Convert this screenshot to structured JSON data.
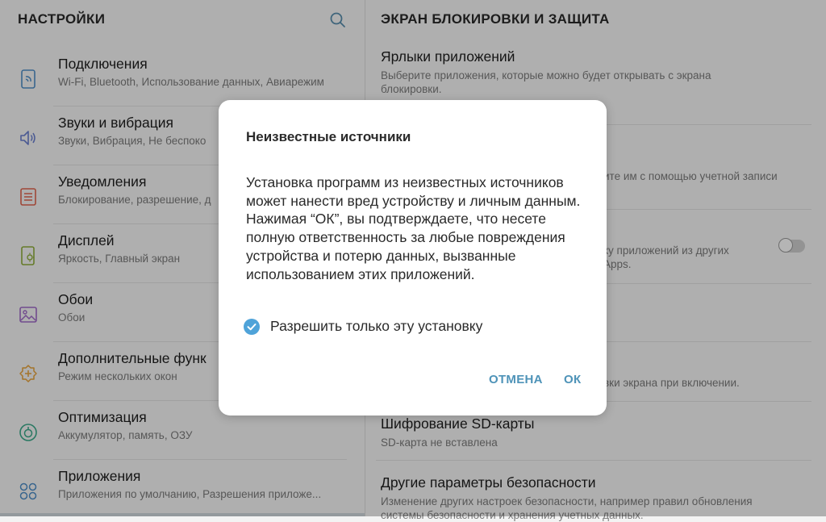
{
  "left": {
    "header": "НАСТРОЙКИ",
    "items": [
      {
        "title": "Подключения",
        "subtitle": "Wi-Fi, Bluetooth, Использование данных, Авиарежим"
      },
      {
        "title": "Звуки и вибрация",
        "subtitle": "Звуки, Вибрация, Не беспоко"
      },
      {
        "title": "Уведомления",
        "subtitle": "Блокирование, разрешение, д"
      },
      {
        "title": "Дисплей",
        "subtitle": "Яркость, Главный экран"
      },
      {
        "title": "Обои",
        "subtitle": "Обои"
      },
      {
        "title": "Дополнительные функ",
        "subtitle": "Режим нескольких окон"
      },
      {
        "title": "Оптимизация",
        "subtitle": "Аккумулятор, память, ОЗУ"
      },
      {
        "title": "Приложения",
        "subtitle": "Приложения по умолчанию, Разрешения приложе..."
      }
    ]
  },
  "right": {
    "header": "ЭКРАН БЛОКИРОВКИ И ЗАЩИТА",
    "app_shortcuts": {
      "title": "Ярлыки приложений",
      "subtitle": "Выберите приложения, которые можно будет открывать с экрана блокировки."
    },
    "fragment_account": "ите им с помощью учетной записи",
    "fragment_unknown": "ку приложений из других",
    "fragment_apps": "Apps.",
    "fragment_power": "вки экрана при включении.",
    "sd_encrypt": {
      "title": "Шифрование SD-карты",
      "subtitle": "SD-карта не вставлена"
    },
    "other_security": {
      "title": "Другие параметры безопасности",
      "subtitle": "Изменение других настроек безопасности, например правил обновления системы безопасности и хранения учетных данных."
    }
  },
  "dialog": {
    "title": "Неизвестные источники",
    "message": "Установка программ из неизвестных источников может нанести вред устройству и личным данным. Нажимая “ОК”, вы подтверждаете, что несете полную ответственность за любые повреждения устройства и потерю данных, вызванные использованием этих приложений.",
    "checkbox_label": "Разрешить только эту установку",
    "checkbox_checked": true,
    "cancel": "ОТМЕНА",
    "ok": "ОК"
  },
  "icons": {
    "connections": "wifi-phone-icon",
    "sounds": "speaker-icon",
    "notifications": "notification-icon",
    "display": "display-icon",
    "wallpaper": "image-icon",
    "advanced": "plus-gear-icon",
    "optimization": "optimization-icon",
    "apps": "apps-grid-icon"
  },
  "colors": {
    "accent": "#4e93b8",
    "check": "#4fa3d9"
  }
}
